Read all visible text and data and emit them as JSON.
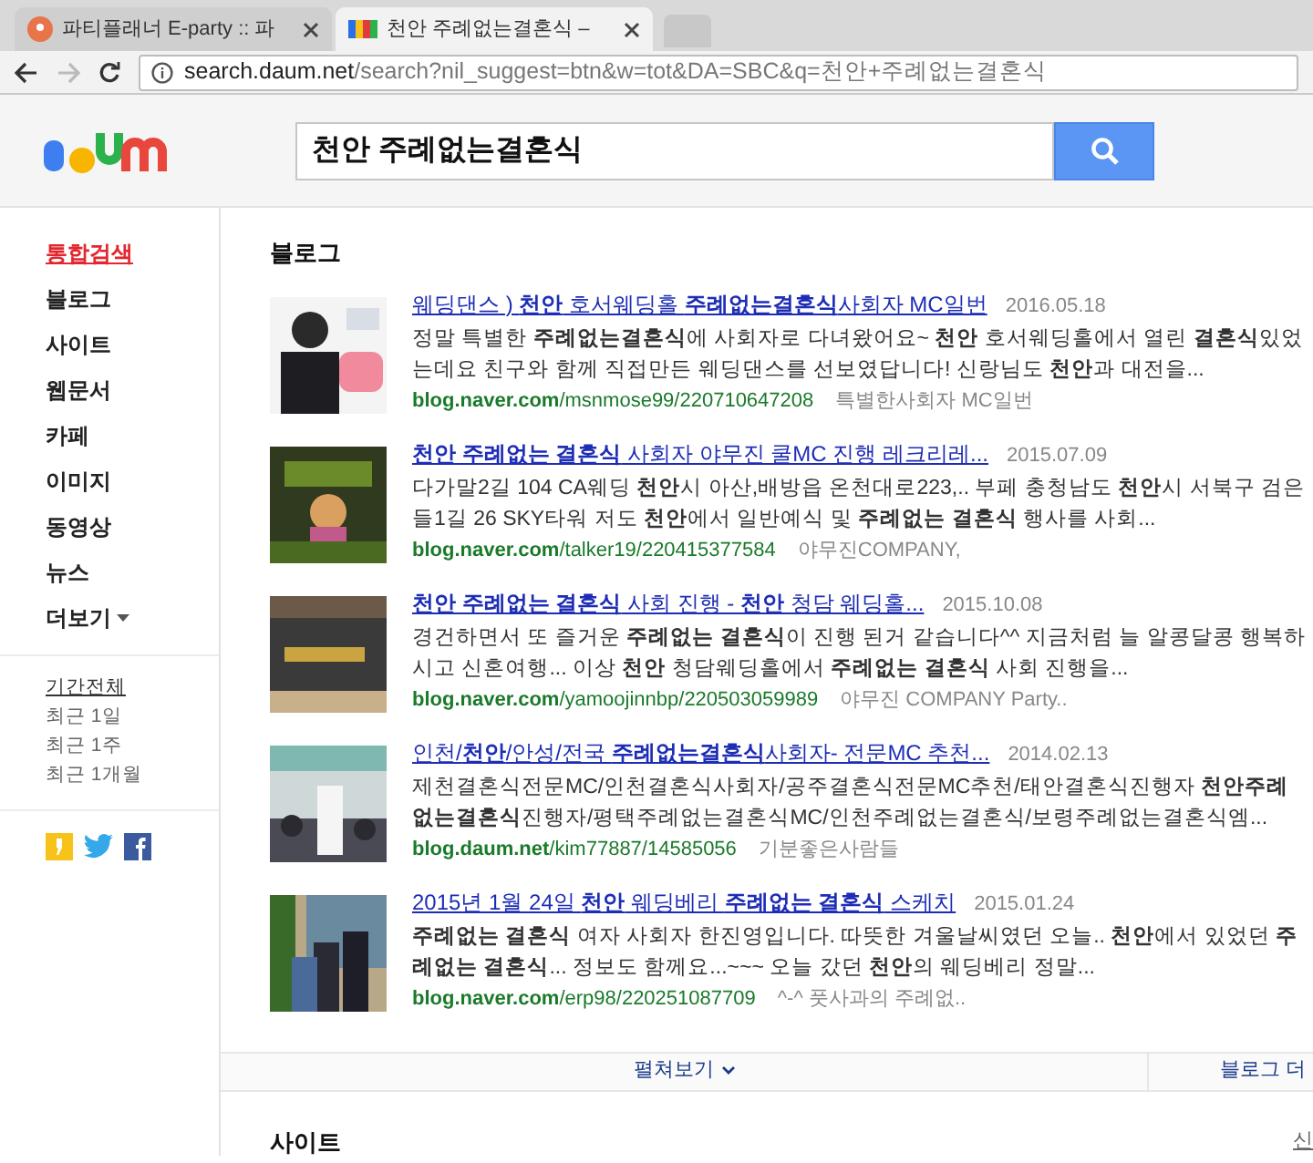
{
  "browser": {
    "tabs": [
      {
        "title": "파티플래너 E-party :: 파",
        "selected": false
      },
      {
        "title": "천안 주례없는결혼식 –",
        "selected": true
      }
    ],
    "address": {
      "host": "search.daum.net",
      "path": "/search?nil_suggest=btn&w=tot&DA=SBC&q=천안+주례없는결혼식"
    }
  },
  "search": {
    "value": "천안 주례없는결혼식"
  },
  "sidebar": {
    "items": [
      {
        "label": "통합검색",
        "selected": true
      },
      {
        "label": "블로그",
        "selected": false
      },
      {
        "label": "사이트",
        "selected": false
      },
      {
        "label": "웹문서",
        "selected": false
      },
      {
        "label": "카페",
        "selected": false
      },
      {
        "label": "이미지",
        "selected": false
      },
      {
        "label": "동영상",
        "selected": false
      },
      {
        "label": "뉴스",
        "selected": false
      },
      {
        "label": "더보기",
        "selected": false,
        "dropdown": true
      }
    ],
    "periods": [
      {
        "label": "기간전체",
        "selected": true
      },
      {
        "label": "최근 1일",
        "selected": false
      },
      {
        "label": "최근 1주",
        "selected": false
      },
      {
        "label": "최근 1개월",
        "selected": false
      }
    ]
  },
  "blog": {
    "heading": "블로그",
    "results": [
      {
        "title": "웨딩댄스 ) **천안** 호서웨딩홀 **주례없는결혼식**사회자 MC일번",
        "date": "2016.05.18",
        "snippet": "정말 특별한 **주례없는결혼식**에 사회자로 다녀왔어요~ **천안** 호서웨딩홀에서 열린 **결혼식**있었는데요 친구와 함께 직접만든 웨딩댄스를 선보였답니다! 신랑님도 **천안**과 대전을...",
        "host": "blog.naver.com",
        "path": "/msnmose99/220710647208",
        "author": "특별한사회자 MC일번"
      },
      {
        "title": "**천안 주례없는 결혼식** 사회자 야무진 쿨MC 진행 레크리레...",
        "date": "2015.07.09",
        "snippet": "다가말2길 104 CA웨딩 **천안**시 아산,배방읍 온천대로223,.. 부페 충청남도 **천안**시 서북구 검은들1길 26 SKY타워 저도 **천안**에서 일반예식 및 **주례없는 결혼식** 행사를 사회...",
        "host": "blog.naver.com",
        "path": "/talker19/220415377584",
        "author": "야무진COMPANY,"
      },
      {
        "title": "**천안 주례없는 결혼식** 사회 진행 - **천안** 청담 웨딩홀...",
        "date": "2015.10.08",
        "snippet": "경건하면서 또 즐거운 **주례없는 결혼식**이 진행 된거 같습니다^^ 지금처럼 늘 알콩달콩 행복하시고 신혼여행... 이상 **천안** 청담웨딩홀에서 **주례없는 결혼식** 사회 진행을...",
        "host": "blog.naver.com",
        "path": "/yamoojinnbp/220503059989",
        "author": "야무진 COMPANY Party.."
      },
      {
        "title": "인천/**천안**/안성/전국 **주례없는결혼식**사회자- 전문MC 추천...",
        "date": "2014.02.13",
        "snippet": "제천결혼식전문MC/인천결혼식사회자/공주결혼식전문MC추천/태안결혼식진행자 **천안주례없는결혼식**진행자/평택주례없는결혼식MC/인천주례없는결혼식/보령주례없는결혼식엠...",
        "host": "blog.daum.net",
        "path": "/kim77887/14585056",
        "author": "기분좋은사람들"
      },
      {
        "title": "2015년 1월 24일 **천안** 웨딩베리 **주례없는 결혼식** 스케치",
        "date": "2015.01.24",
        "snippet": "**주례없는 결혼식** 여자 사회자 한진영입니다. 따뜻한 겨울날씨였던 오늘.. **천안**에서 있었던 **주례없는 결혼식**... 정보도 함께요...~~~ 오늘 갔던 **천안**의 웨딩베리 정말...",
        "host": "blog.naver.com",
        "path": "/erp98/220251087709",
        "author": "^-^ 풋사과의 주례없.."
      }
    ],
    "expand": "펼쳐보기",
    "more": "블로그 더"
  },
  "site": {
    "heading": "사이트",
    "link": "신"
  }
}
